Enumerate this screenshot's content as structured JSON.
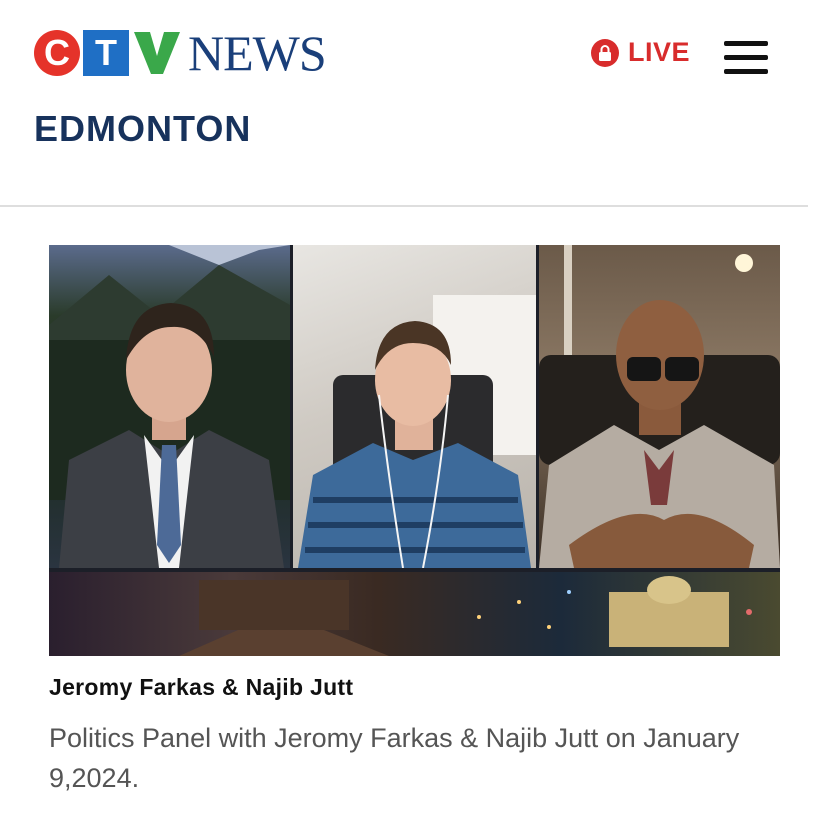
{
  "brand": {
    "logo_letters": [
      "C",
      "T",
      "V"
    ],
    "logo_word": "NEWS",
    "city": "EDMONTON",
    "colors": {
      "c_red": "#e5332a",
      "t_blue": "#1f6fc5",
      "v_green": "#3aa84a",
      "news_navy": "#1a3f7a",
      "city_navy": "#17325c"
    }
  },
  "header": {
    "live_label": "LIVE",
    "live_color": "#d82c2c",
    "live_icon": "lock-icon",
    "menu_icon": "hamburger-menu-icon"
  },
  "video": {
    "thumbnail_panels": [
      "anchor-studio",
      "guest-home-office",
      "guest-dark-office"
    ],
    "banner": "edmonton-skyline-night",
    "title": "Jeromy Farkas & Najib Jutt",
    "description": "Politics Panel with Jeromy Farkas & Najib Jutt on January 9,2024."
  }
}
